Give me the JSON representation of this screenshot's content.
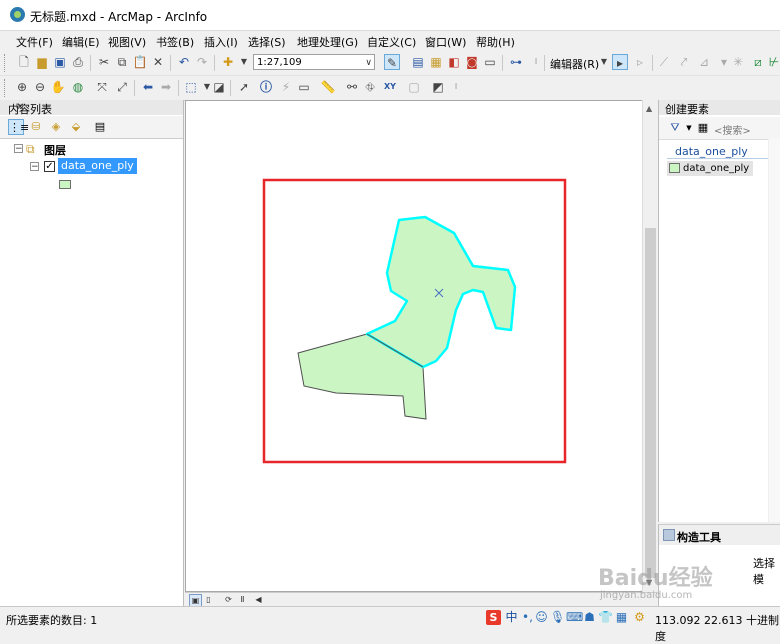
{
  "window": {
    "title": "无标题.mxd - ArcMap - ArcInfo"
  },
  "menu": [
    "文件(F)",
    "编辑(E)",
    "视图(V)",
    "书签(B)",
    "插入(I)",
    "选择(S)",
    "地理处理(G)",
    "自定义(C)",
    "窗口(W)",
    "帮助(H)"
  ],
  "toolbar": {
    "scale_value": "1:27,109",
    "editor_label": "编辑器(R)"
  },
  "toc": {
    "title": "内容列表",
    "group_label": "图层",
    "layer_name": "data_one_ply",
    "layer_checked": true
  },
  "create_features": {
    "title": "创建要素",
    "search_placeholder": "<搜索>",
    "template_group": "data_one_ply",
    "template_item": "data_one_ply"
  },
  "construct_tools": {
    "title": "构造工具",
    "hint": "选择模"
  },
  "status": {
    "selection_count": "所选要素的数目: 1",
    "coords": "113.092  22.613 十进制度"
  },
  "watermark": {
    "text": "Baidu经验",
    "sub": "jingyan.baidu.com"
  },
  "colors": {
    "selection_outline": "#00ffff",
    "polygon_fill": "#ccf5c4",
    "frame_red": "#e8262a",
    "highlight": "#3399ff"
  },
  "icons": [
    "new-icon",
    "open-icon",
    "save-icon",
    "print-icon",
    "cut-icon",
    "copy-icon",
    "paste-icon",
    "delete-icon",
    "undo-icon",
    "redo-icon",
    "add-data-icon",
    "zoom-in-icon",
    "zoom-out-icon",
    "pan-icon",
    "globe-icon",
    "full-extent-icon",
    "back-icon",
    "forward-icon",
    "select-icon",
    "identify-icon",
    "find-icon",
    "binoculars-icon",
    "xy-icon",
    "edit-tool-icon"
  ]
}
